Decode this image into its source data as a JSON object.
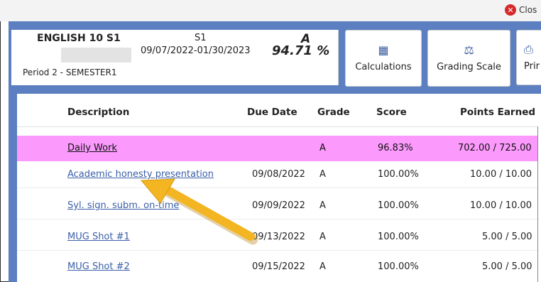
{
  "topbar": {
    "close_label": "Clos"
  },
  "course": {
    "name": "ENGLISH 10 S1",
    "term": "S1",
    "letter_grade": "A",
    "date_range": "09/07/2022-01/30/2023",
    "percent": "94.71 %",
    "period": "Period 2 - SEMESTER1"
  },
  "toolbar": {
    "calculations_label": "Calculations",
    "grading_scale_label": "Grading Scale",
    "print_label": "Prir"
  },
  "table": {
    "headers": [
      "Description",
      "Due Date",
      "Grade",
      "Score",
      "Points Earned"
    ],
    "rows": [
      {
        "description": "Daily Work",
        "due": "",
        "grade": "A",
        "score": "96.83%",
        "points": "702.00 / 725.00"
      },
      {
        "description": "Academic honesty presentation",
        "due": "09/08/2022",
        "grade": "A",
        "score": "100.00%",
        "points": "10.00 / 10.00"
      },
      {
        "description": "Syl. sign. subm. on-time",
        "due": "09/09/2022",
        "grade": "A",
        "score": "100.00%",
        "points": "10.00 / 10.00"
      },
      {
        "description": "MUG Shot #1",
        "due": "09/13/2022",
        "grade": "A",
        "score": "100.00%",
        "points": "5.00 / 5.00"
      },
      {
        "description": "MUG Shot #2",
        "due": "09/15/2022",
        "grade": "A",
        "score": "100.00%",
        "points": "5.00 / 5.00"
      }
    ]
  },
  "colors": {
    "panel": "#5b7fc0",
    "highlight": "#fb9afc",
    "link": "#3a5ea8",
    "arrow": "#f3b521"
  }
}
